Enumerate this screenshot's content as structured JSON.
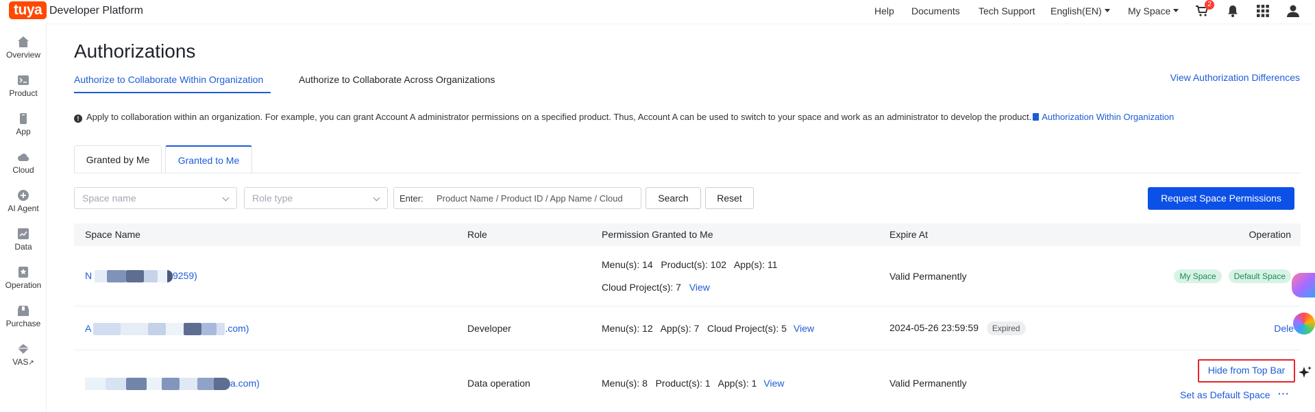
{
  "topbar": {
    "logo": "tuya",
    "brand": "Developer Platform",
    "nav": [
      "Help",
      "Documents",
      "Tech Support"
    ],
    "language": "English(EN)",
    "space": "My Space",
    "cart_badge": "2"
  },
  "sidebar": {
    "items": [
      {
        "label": "Overview",
        "icon": "home-icon"
      },
      {
        "label": "Product",
        "icon": "terminal-icon"
      },
      {
        "label": "App",
        "icon": "phone-icon"
      },
      {
        "label": "Cloud",
        "icon": "cloud-icon"
      },
      {
        "label": "AI Agent",
        "icon": "plus-circle-icon"
      },
      {
        "label": "Data",
        "icon": "chart-icon"
      },
      {
        "label": "Operation",
        "icon": "bookmark-icon"
      },
      {
        "label": "Purchase",
        "icon": "box-icon"
      },
      {
        "label": "VAS",
        "icon": "diamond-icon",
        "ext": "↗"
      }
    ]
  },
  "page": {
    "title": "Authorizations",
    "tabs": [
      "Authorize to Collaborate Within Organization",
      "Authorize to Collaborate Across Organizations"
    ],
    "view_diff": "View Authorization Differences",
    "info_text": "Apply to collaboration within an organization. For example, you can grant Account A administrator permissions on a specified product. Thus, Account A can be used to switch to your space and work as an administrator to develop the product.",
    "info_link": "Authorization Within Organization",
    "subtabs": [
      "Granted by Me",
      "Granted to Me"
    ]
  },
  "filters": {
    "space_placeholder": "Space name",
    "role_placeholder": "Role type",
    "enter_label": "Enter:",
    "enter_placeholder": "Product Name / Product ID / App Name / Cloud",
    "search": "Search",
    "reset": "Reset",
    "request": "Request Space Permissions"
  },
  "table": {
    "headers": {
      "space_name": "Space Name",
      "role": "Role",
      "permission": "Permission Granted to Me",
      "expire": "Expire At",
      "operation": "Operation"
    },
    "rows": [
      {
        "name_prefix": "N",
        "name_suffix": "9259)",
        "role": "",
        "perm_line1": "Menu(s): 14   Product(s): 102   App(s): 11",
        "perm_line2": "Cloud Project(s): 7",
        "view": "View",
        "expire": "Valid Permanently",
        "tags": [
          "My Space",
          "Default Space"
        ]
      },
      {
        "name_prefix": "A",
        "name_suffix": ".com)",
        "role": "Developer",
        "perm_line1": "Menu(s): 12   App(s): 7   Cloud Project(s): 5",
        "view": "View",
        "expire": "2024-05-26 23:59:59",
        "expired_tag": "Expired",
        "op": "Dele"
      },
      {
        "name_prefix": "",
        "name_suffix": "a.com)",
        "role": "Data operation",
        "perm_line1": "Menu(s): 8   Product(s): 1   App(s): 1",
        "view": "View",
        "expire": "Valid Permanently",
        "op_hide": "Hide from Top Bar",
        "op_default": "Set as Default Space",
        "op_more": "···"
      }
    ]
  },
  "colors": {
    "accent": "#1d5bd8",
    "primary_button": "#0b50e7",
    "highlight_border": "#e5242b",
    "logo": "#ff4800"
  }
}
